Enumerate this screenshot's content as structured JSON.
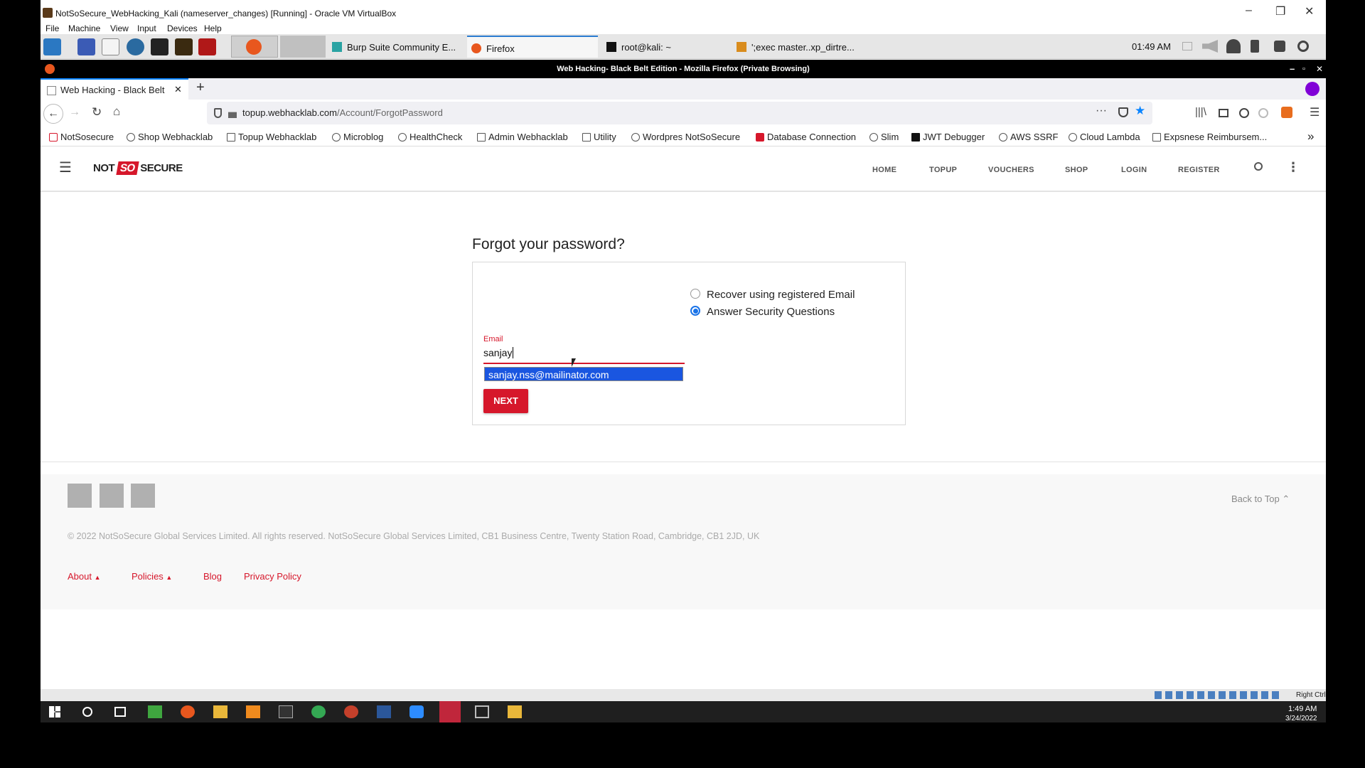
{
  "vbox": {
    "window_title": "NotSoSecure_WebHacking_Kali (nameserver_changes) [Running] - Oracle VM VirtualBox",
    "menu": [
      "File",
      "Machine",
      "View",
      "Input",
      "Devices",
      "Help"
    ],
    "minimize": "–",
    "restore": "❐",
    "close": "✕",
    "status_host_key": "Right Ctrl"
  },
  "kali": {
    "tasks": [
      {
        "label": "Burp Suite Community E..."
      },
      {
        "label": "Firefox"
      },
      {
        "label": "root@kali: ~"
      },
      {
        "label": "';exec master..xp_dirtre..."
      }
    ],
    "clock": "01:49 AM"
  },
  "firefox": {
    "window_title": "Web Hacking- Black Belt Edition - Mozilla Firefox (Private Browsing)",
    "tab_title": "Web Hacking - Black Belt",
    "new_tab": "+",
    "url_host": "topup.webhacklab.com",
    "url_path": "/Account/ForgotPassword",
    "bookmarks": [
      "NotSosecure",
      "Shop Webhacklab",
      "Topup Webhacklab",
      "Microblog",
      "HealthCheck",
      "Admin Webhacklab",
      "Utility",
      "Wordpres NotSoSecure",
      "Database Connection",
      "Slim",
      "JWT Debugger",
      "AWS SSRF",
      "Cloud Lambda",
      "Expsnese Reimbursem..."
    ],
    "more": "»"
  },
  "site": {
    "logo": {
      "not": "NOT",
      "so": "SO",
      "secure": "SECURE"
    },
    "nav": [
      "HOME",
      "TOPUP",
      "VOUCHERS",
      "SHOP",
      "LOGIN",
      "REGISTER"
    ],
    "page_title": "Forgot your password?",
    "options": [
      {
        "label": "Recover using registered Email",
        "selected": false
      },
      {
        "label": "Answer Security Questions",
        "selected": true
      }
    ],
    "email_label": "Email",
    "email_value": "sanjay",
    "autocomplete": "sanjay.nss@mailinator.com",
    "next_button": "NEXT",
    "footer": {
      "back_to_top": "Back to Top",
      "copyright": "© 2022 NotSoSecure Global Services Limited. All rights reserved. NotSoSecure Global Services Limited, CB1 Business Centre, Twenty Station Road, Cambridge, CB1 2JD, UK",
      "links": [
        "About",
        "Policies",
        "Blog",
        "Privacy Policy"
      ]
    }
  },
  "windows": {
    "clock_time": "1:49 AM",
    "clock_date": "3/24/2022"
  },
  "colors": {
    "accent_red": "#d6172b",
    "focus_blue": "#0a84ff"
  }
}
